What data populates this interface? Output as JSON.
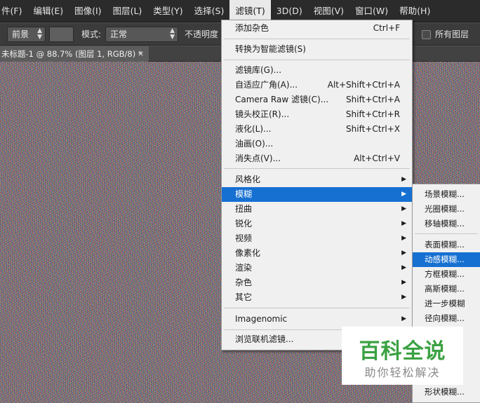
{
  "menubar": {
    "items": [
      "件(F)",
      "编辑(E)",
      "图像(I)",
      "图层(L)",
      "类型(Y)",
      "选择(S)",
      "滤镜(T)",
      "3D(D)",
      "视图(V)",
      "窗口(W)",
      "帮助(H)"
    ]
  },
  "options_bar": {
    "source_value": "前景",
    "mode_label": "模式:",
    "mode_value": "正常",
    "opacity_label": "不透明度",
    "all_layers_label": "所有图层"
  },
  "document_tab": {
    "title": "未标题-1 @ 88.7% (图层 1, RGB/8) *",
    "close": "×"
  },
  "filter_menu": {
    "items": [
      {
        "label": "添加杂色",
        "shortcut": "Ctrl+F"
      },
      {
        "label": "转换为智能滤镜(S)",
        "shortcut": ""
      },
      {
        "label": "滤镜库(G)...",
        "shortcut": ""
      },
      {
        "label": "自适应广角(A)...",
        "shortcut": "Alt+Shift+Ctrl+A"
      },
      {
        "label": "Camera Raw 滤镜(C)...",
        "shortcut": "Shift+Ctrl+A"
      },
      {
        "label": "镜头校正(R)...",
        "shortcut": "Shift+Ctrl+R"
      },
      {
        "label": "液化(L)...",
        "shortcut": "Shift+Ctrl+X"
      },
      {
        "label": "油画(O)...",
        "shortcut": ""
      },
      {
        "label": "消失点(V)...",
        "shortcut": "Alt+Ctrl+V"
      },
      {
        "label": "风格化",
        "submenu": true
      },
      {
        "label": "模糊",
        "submenu": true,
        "highlighted": true
      },
      {
        "label": "扭曲",
        "submenu": true
      },
      {
        "label": "锐化",
        "submenu": true
      },
      {
        "label": "视频",
        "submenu": true
      },
      {
        "label": "像素化",
        "submenu": true
      },
      {
        "label": "渲染",
        "submenu": true
      },
      {
        "label": "杂色",
        "submenu": true
      },
      {
        "label": "其它",
        "submenu": true
      },
      {
        "label": "Imagenomic",
        "submenu": true
      },
      {
        "label": "浏览联机滤镜...",
        "shortcut": ""
      }
    ],
    "arrow": "▶"
  },
  "blur_submenu": {
    "items": [
      "场景模糊...",
      "光圈模糊...",
      "移轴模糊...",
      "表面模糊...",
      "动感模糊...",
      "方框模糊...",
      "高斯模糊...",
      "进一步模糊",
      "径向模糊...",
      "形状模糊..."
    ],
    "highlighted": "动感模糊..."
  },
  "watermark": {
    "title": "百科全说",
    "subtitle": "助你轻松解决",
    "title_color": "#3aa141"
  },
  "colors": {
    "menu_highlight": "#1670d2",
    "menubar_bg": "#2b2b2b",
    "options_bg": "#3b3b3b"
  }
}
